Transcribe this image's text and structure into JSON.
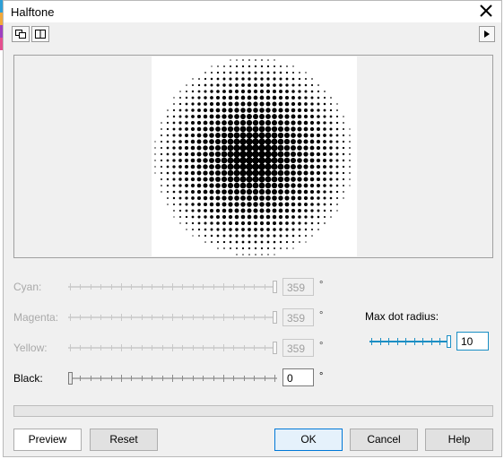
{
  "window": {
    "title": "Halftone"
  },
  "toolbar": {
    "left_icons": [
      "duplicate-view-icon",
      "split-view-icon"
    ],
    "right_icon": "expand-arrow-icon"
  },
  "preview": {
    "image": "halftone-dots-preview"
  },
  "channels": [
    {
      "label": "Cyan:",
      "value": "359",
      "unit": "°",
      "level": 1.0,
      "enabled": false
    },
    {
      "label": "Magenta:",
      "value": "359",
      "unit": "°",
      "level": 1.0,
      "enabled": false
    },
    {
      "label": "Yellow:",
      "value": "359",
      "unit": "°",
      "level": 1.0,
      "enabled": false
    },
    {
      "label": "Black:",
      "value": "0",
      "unit": "°",
      "level": 0.0,
      "enabled": true
    }
  ],
  "max_dot_radius": {
    "label": "Max dot radius:",
    "value": "10",
    "level": 1.0
  },
  "progress": {
    "fraction": 0
  },
  "buttons": {
    "preview": "Preview",
    "reset": "Reset",
    "ok": "OK",
    "cancel": "Cancel",
    "help": "Help"
  },
  "colors": {
    "accent": "#1a8ec4",
    "ok_border": "#0078d7",
    "background_strip": [
      "#2e9fd6",
      "#f2a93b",
      "#9f3fc0",
      "#e44f8f"
    ]
  }
}
